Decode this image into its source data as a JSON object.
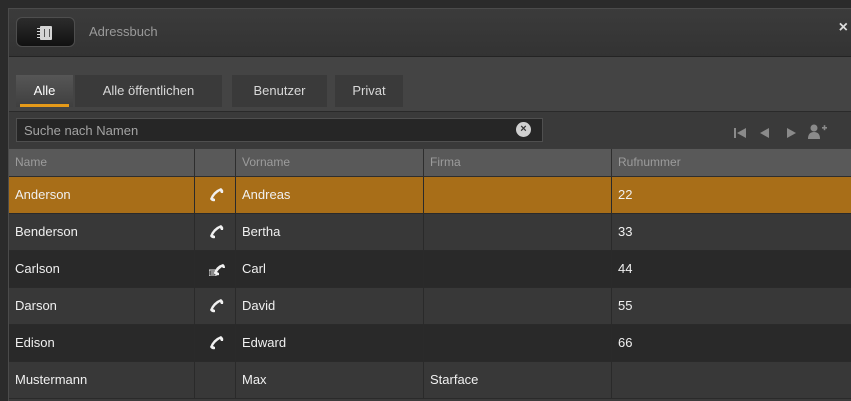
{
  "window": {
    "title": "Adressbuch",
    "close_label": "×"
  },
  "tabs": [
    {
      "label": "Alle",
      "active": true
    },
    {
      "label": "Alle öffentlichen",
      "active": false
    },
    {
      "label": "Benutzer",
      "active": false
    },
    {
      "label": "Privat",
      "active": false
    }
  ],
  "search": {
    "placeholder": "Suche nach Namen",
    "value": ""
  },
  "pager": {
    "first": "first-page-icon",
    "prev": "prev-page-icon",
    "next": "next-page-icon",
    "add": "add-contact-icon"
  },
  "table": {
    "columns": [
      "Name",
      "",
      "Vorname",
      "Firma",
      "Rufnummer"
    ],
    "rows": [
      {
        "name": "Anderson",
        "icon": "phone-icon",
        "first": "Andreas",
        "firm": "",
        "number": "22",
        "selected": true
      },
      {
        "name": "Benderson",
        "icon": "phone-icon",
        "first": "Bertha",
        "firm": "",
        "number": "33"
      },
      {
        "name": "Carlson",
        "icon": "phone-list-icon",
        "first": "Carl",
        "firm": "",
        "number": "44"
      },
      {
        "name": "Darson",
        "icon": "phone-icon",
        "first": "David",
        "firm": "",
        "number": "55"
      },
      {
        "name": "Edison",
        "icon": "phone-icon",
        "first": "Edward",
        "firm": "",
        "number": "66"
      },
      {
        "name": "Mustermann",
        "icon": "",
        "first": "Max",
        "firm": "Starface",
        "number": ""
      }
    ]
  },
  "colors": {
    "accent": "#e59a19",
    "selected_row": "#a86e18"
  }
}
